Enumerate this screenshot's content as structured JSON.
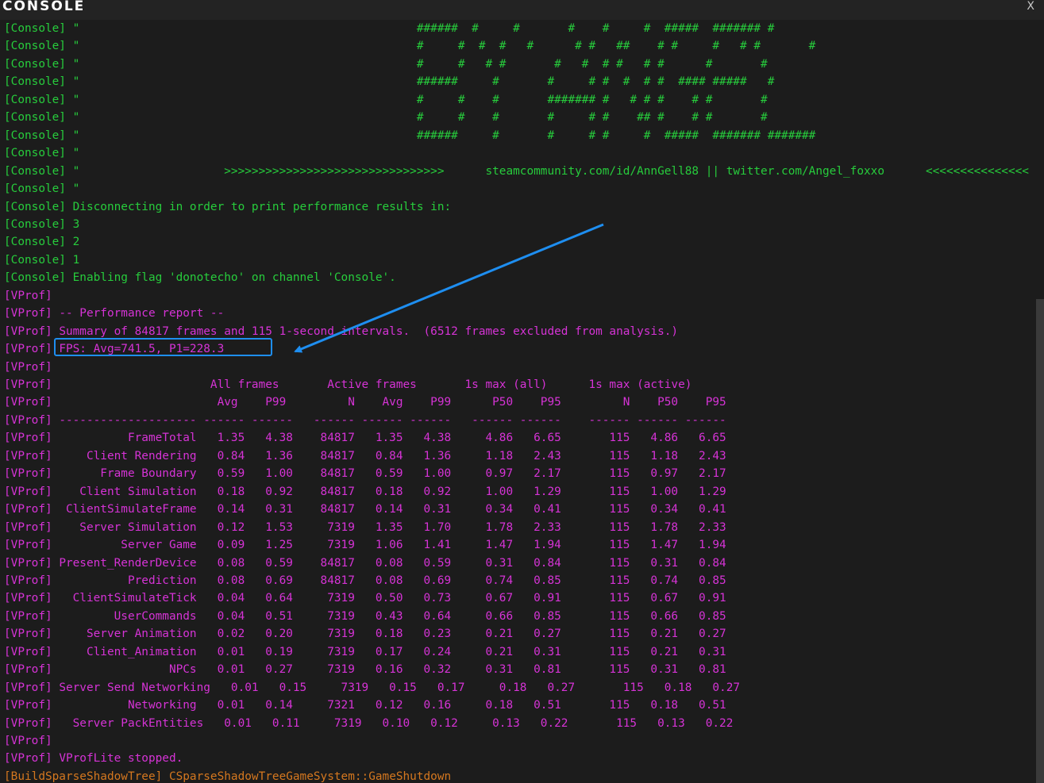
{
  "window": {
    "title": "CONSOLE",
    "close_label": "X"
  },
  "colors": {
    "console": "#27cc3c",
    "vprof": "#d633d6",
    "build": "#d4771f",
    "highlight": "#1e8ef0"
  },
  "lines": [
    {
      "prefix": "[Console]",
      "text": " \"                                                 ######  #     #       #    #     #  #####  ####### #",
      "kind": "console"
    },
    {
      "prefix": "[Console]",
      "text": " \"                                                 #     #  #  #   #      # #   ##    # #     #   # #       #",
      "kind": "console"
    },
    {
      "prefix": "[Console]",
      "text": " \"                                                 #     #   # #       #   #  # #   # #      #       #",
      "kind": "console"
    },
    {
      "prefix": "[Console]",
      "text": " \"                                                 ######     #       #     # #  #  # #  #### #####   #",
      "kind": "console"
    },
    {
      "prefix": "[Console]",
      "text": " \"                                                 #     #    #       ####### #   # # #    # #       #",
      "kind": "console"
    },
    {
      "prefix": "[Console]",
      "text": " \"                                                 #     #    #       #     # #    ## #    # #       #",
      "kind": "console"
    },
    {
      "prefix": "[Console]",
      "text": " \"                                                 ######     #       #     # #     #  #####  ####### #######",
      "kind": "console"
    },
    {
      "prefix": "[Console]",
      "text": " \"",
      "kind": "console"
    },
    {
      "prefix": "[Console]",
      "text": " \"                     >>>>>>>>>>>>>>>>>>>>>>>>>>>>>>>>      steamcommunity.com/id/AnnGell88 || twitter.com/Angel_foxxo      <<<<<<<<<<<<<<<",
      "kind": "console"
    },
    {
      "prefix": "[Console]",
      "text": " \"",
      "kind": "console"
    },
    {
      "prefix": "[Console]",
      "text": " Disconnecting in order to print performance results in:",
      "kind": "console"
    },
    {
      "prefix": "[Console]",
      "text": " 3",
      "kind": "console"
    },
    {
      "prefix": "[Console]",
      "text": " 2",
      "kind": "console"
    },
    {
      "prefix": "[Console]",
      "text": " 1",
      "kind": "console"
    },
    {
      "prefix": "[Console]",
      "text": " Enabling flag 'donotecho' on channel 'Console'.",
      "kind": "console"
    },
    {
      "prefix": "[VProf]",
      "text": "",
      "kind": "vprof"
    },
    {
      "prefix": "[VProf]",
      "text": " -- Performance report --",
      "kind": "vprof"
    },
    {
      "prefix": "[VProf]",
      "text": " Summary of 84817 frames and 115 1-second intervals.  (6512 frames excluded from analysis.)",
      "kind": "vprof"
    },
    {
      "prefix": "[VProf]",
      "text": " FPS: Avg=741.5, P1=228.3",
      "kind": "vprof"
    },
    {
      "prefix": "[VProf]",
      "text": "",
      "kind": "vprof"
    },
    {
      "prefix": "[VProf]",
      "text": "                       All frames       Active frames       1s max (all)      1s max (active)",
      "kind": "vprof"
    },
    {
      "prefix": "[VProf]",
      "text": "                        Avg    P99         N    Avg    P99      P50    P95         N    P50    P95",
      "kind": "vprof"
    },
    {
      "prefix": "[VProf]",
      "text": " -------------------- ------ ------   ------ ------ ------   ------ ------    ------ ------ ------",
      "kind": "vprof"
    },
    {
      "prefix": "[VProf]",
      "text": "           FrameTotal   1.35   4.38    84817   1.35   4.38     4.86   6.65       115   4.86   6.65",
      "kind": "vprof"
    },
    {
      "prefix": "[VProf]",
      "text": "     Client Rendering   0.84   1.36    84817   0.84   1.36     1.18   2.43       115   1.18   2.43",
      "kind": "vprof"
    },
    {
      "prefix": "[VProf]",
      "text": "       Frame Boundary   0.59   1.00    84817   0.59   1.00     0.97   2.17       115   0.97   2.17",
      "kind": "vprof"
    },
    {
      "prefix": "[VProf]",
      "text": "    Client Simulation   0.18   0.92    84817   0.18   0.92     1.00   1.29       115   1.00   1.29",
      "kind": "vprof"
    },
    {
      "prefix": "[VProf]",
      "text": "  ClientSimulateFrame   0.14   0.31    84817   0.14   0.31     0.34   0.41       115   0.34   0.41",
      "kind": "vprof"
    },
    {
      "prefix": "[VProf]",
      "text": "    Server Simulation   0.12   1.53     7319   1.35   1.70     1.78   2.33       115   1.78   2.33",
      "kind": "vprof"
    },
    {
      "prefix": "[VProf]",
      "text": "          Server Game   0.09   1.25     7319   1.06   1.41     1.47   1.94       115   1.47   1.94",
      "kind": "vprof"
    },
    {
      "prefix": "[VProf]",
      "text": " Present_RenderDevice   0.08   0.59    84817   0.08   0.59     0.31   0.84       115   0.31   0.84",
      "kind": "vprof"
    },
    {
      "prefix": "[VProf]",
      "text": "           Prediction   0.08   0.69    84817   0.08   0.69     0.74   0.85       115   0.74   0.85",
      "kind": "vprof"
    },
    {
      "prefix": "[VProf]",
      "text": "   ClientSimulateTick   0.04   0.64     7319   0.50   0.73     0.67   0.91       115   0.67   0.91",
      "kind": "vprof"
    },
    {
      "prefix": "[VProf]",
      "text": "         UserCommands   0.04   0.51     7319   0.43   0.64     0.66   0.85       115   0.66   0.85",
      "kind": "vprof"
    },
    {
      "prefix": "[VProf]",
      "text": "     Server Animation   0.02   0.20     7319   0.18   0.23     0.21   0.27       115   0.21   0.27",
      "kind": "vprof"
    },
    {
      "prefix": "[VProf]",
      "text": "     Client_Animation   0.01   0.19     7319   0.17   0.24     0.21   0.31       115   0.21   0.31",
      "kind": "vprof"
    },
    {
      "prefix": "[VProf]",
      "text": "                 NPCs   0.01   0.27     7319   0.16   0.32     0.31   0.81       115   0.31   0.81",
      "kind": "vprof"
    },
    {
      "prefix": "[VProf]",
      "text": " Server Send Networking   0.01   0.15     7319   0.15   0.17     0.18   0.27       115   0.18   0.27",
      "kind": "vprof"
    },
    {
      "prefix": "[VProf]",
      "text": "           Networking   0.01   0.14     7321   0.12   0.16     0.18   0.51       115   0.18   0.51",
      "kind": "vprof"
    },
    {
      "prefix": "[VProf]",
      "text": "   Server PackEntities   0.01   0.11     7319   0.10   0.12     0.13   0.22       115   0.13   0.22",
      "kind": "vprof"
    },
    {
      "prefix": "[VProf]",
      "text": "",
      "kind": "vprof"
    },
    {
      "prefix": "[VProf]",
      "text": " VProfLite stopped.",
      "kind": "vprof"
    },
    {
      "prefix": "[BuildSparseShadowTree]",
      "text": " CSparseShadowTreeGameSystem::GameShutdown",
      "kind": "build"
    }
  ]
}
